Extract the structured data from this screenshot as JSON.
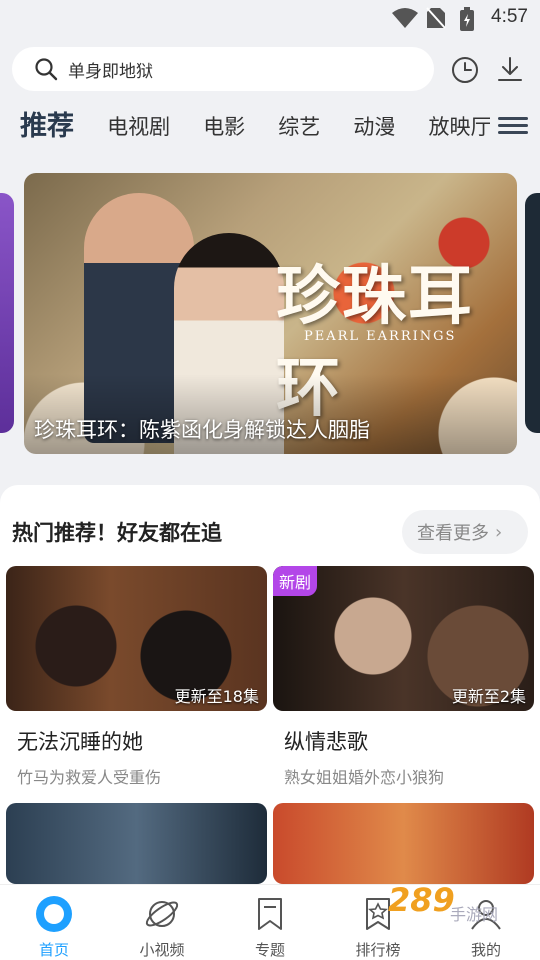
{
  "status_bar": {
    "time": "4:57"
  },
  "search": {
    "query": "单身即地狱"
  },
  "tabs": [
    "推荐",
    "电视剧",
    "电影",
    "综艺",
    "动漫",
    "放映厅"
  ],
  "banner": {
    "logo_text": "珍珠耳环",
    "logo_en": "PEARL EARRINGS",
    "caption": "珍珠耳环：陈紫函化身解锁达人胭脂"
  },
  "section": {
    "title": "热门推荐！好友都在追",
    "more_label": "查看更多"
  },
  "cards": [
    {
      "title": "无法沉睡的她",
      "subtitle": "竹马为救爱人受重伤",
      "update": "更新至18集",
      "badge": ""
    },
    {
      "title": "纵情悲歌",
      "subtitle": "熟女姐姐婚外恋小狼狗",
      "update": "更新至2集",
      "badge": "新剧"
    }
  ],
  "bottom_nav": [
    {
      "label": "首页",
      "icon": "home-icon"
    },
    {
      "label": "小视频",
      "icon": "planet-icon"
    },
    {
      "label": "专题",
      "icon": "bookmark-icon"
    },
    {
      "label": "排行榜",
      "icon": "ranking-icon"
    },
    {
      "label": "我的",
      "icon": "profile-icon"
    }
  ],
  "watermark": {
    "number": "289",
    "text": "手游网"
  },
  "colors": {
    "accent": "#1ea0ff",
    "badge": "#b346e8"
  }
}
